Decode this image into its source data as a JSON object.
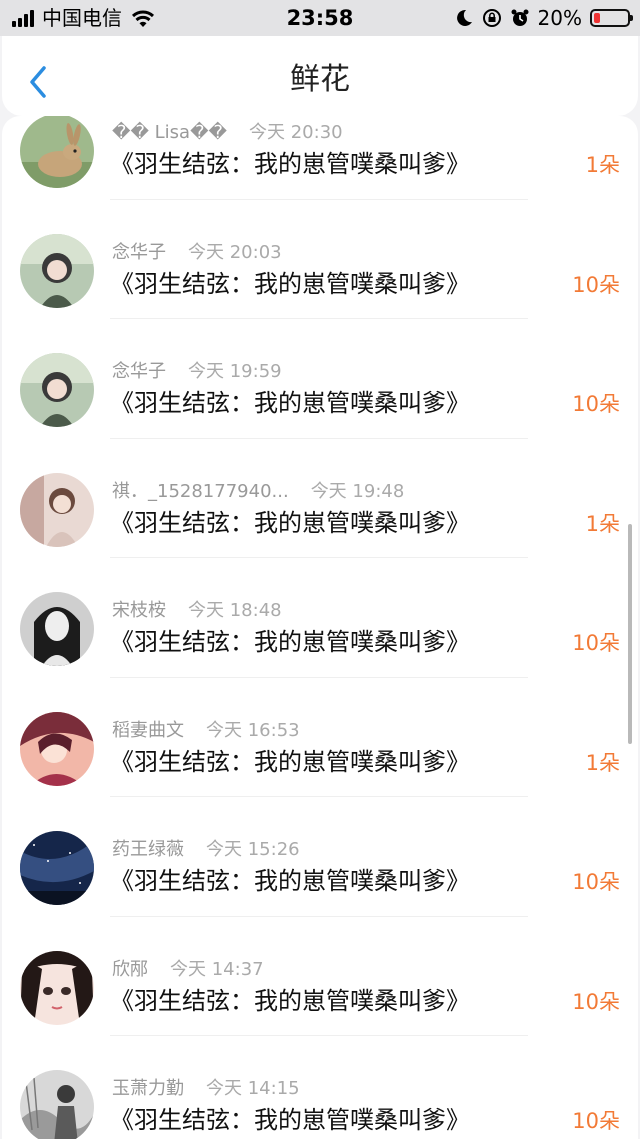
{
  "status_bar": {
    "carrier": "中国电信",
    "time": "23:58",
    "battery_percent": "20%",
    "battery_level": 0.2
  },
  "header": {
    "title": "鲜花"
  },
  "gifts": [
    {
      "name": "�� Lisa��",
      "time": "今天 20:30",
      "book": "《羽生结弦：我的崽管噗桑叫爹》",
      "count": "1朵"
    },
    {
      "name": "念华子",
      "time": "今天 20:03",
      "book": "《羽生结弦：我的崽管噗桑叫爹》",
      "count": "10朵"
    },
    {
      "name": "念华子",
      "time": "今天 19:59",
      "book": "《羽生结弦：我的崽管噗桑叫爹》",
      "count": "10朵"
    },
    {
      "name": "祺．_1528177940...",
      "time": "今天 19:48",
      "book": "《羽生结弦：我的崽管噗桑叫爹》",
      "count": "1朵"
    },
    {
      "name": "宋枝桉",
      "time": "今天 18:48",
      "book": "《羽生结弦：我的崽管噗桑叫爹》",
      "count": "10朵"
    },
    {
      "name": "稻妻曲文",
      "time": "今天 16:53",
      "book": "《羽生结弦：我的崽管噗桑叫爹》",
      "count": "1朵"
    },
    {
      "name": "药王绿薇",
      "time": "今天 15:26",
      "book": "《羽生结弦：我的崽管噗桑叫爹》",
      "count": "10朵"
    },
    {
      "name": "欣邴",
      "time": "今天 14:37",
      "book": "《羽生结弦：我的崽管噗桑叫爹》",
      "count": "10朵"
    },
    {
      "name": "玉萧力勤",
      "time": "今天 14:15",
      "book": "《羽生结弦：我的崽管噗桑叫爹》",
      "count": "10朵"
    }
  ],
  "colors": {
    "accent": "#f27a36",
    "back": "#2b8de0"
  }
}
